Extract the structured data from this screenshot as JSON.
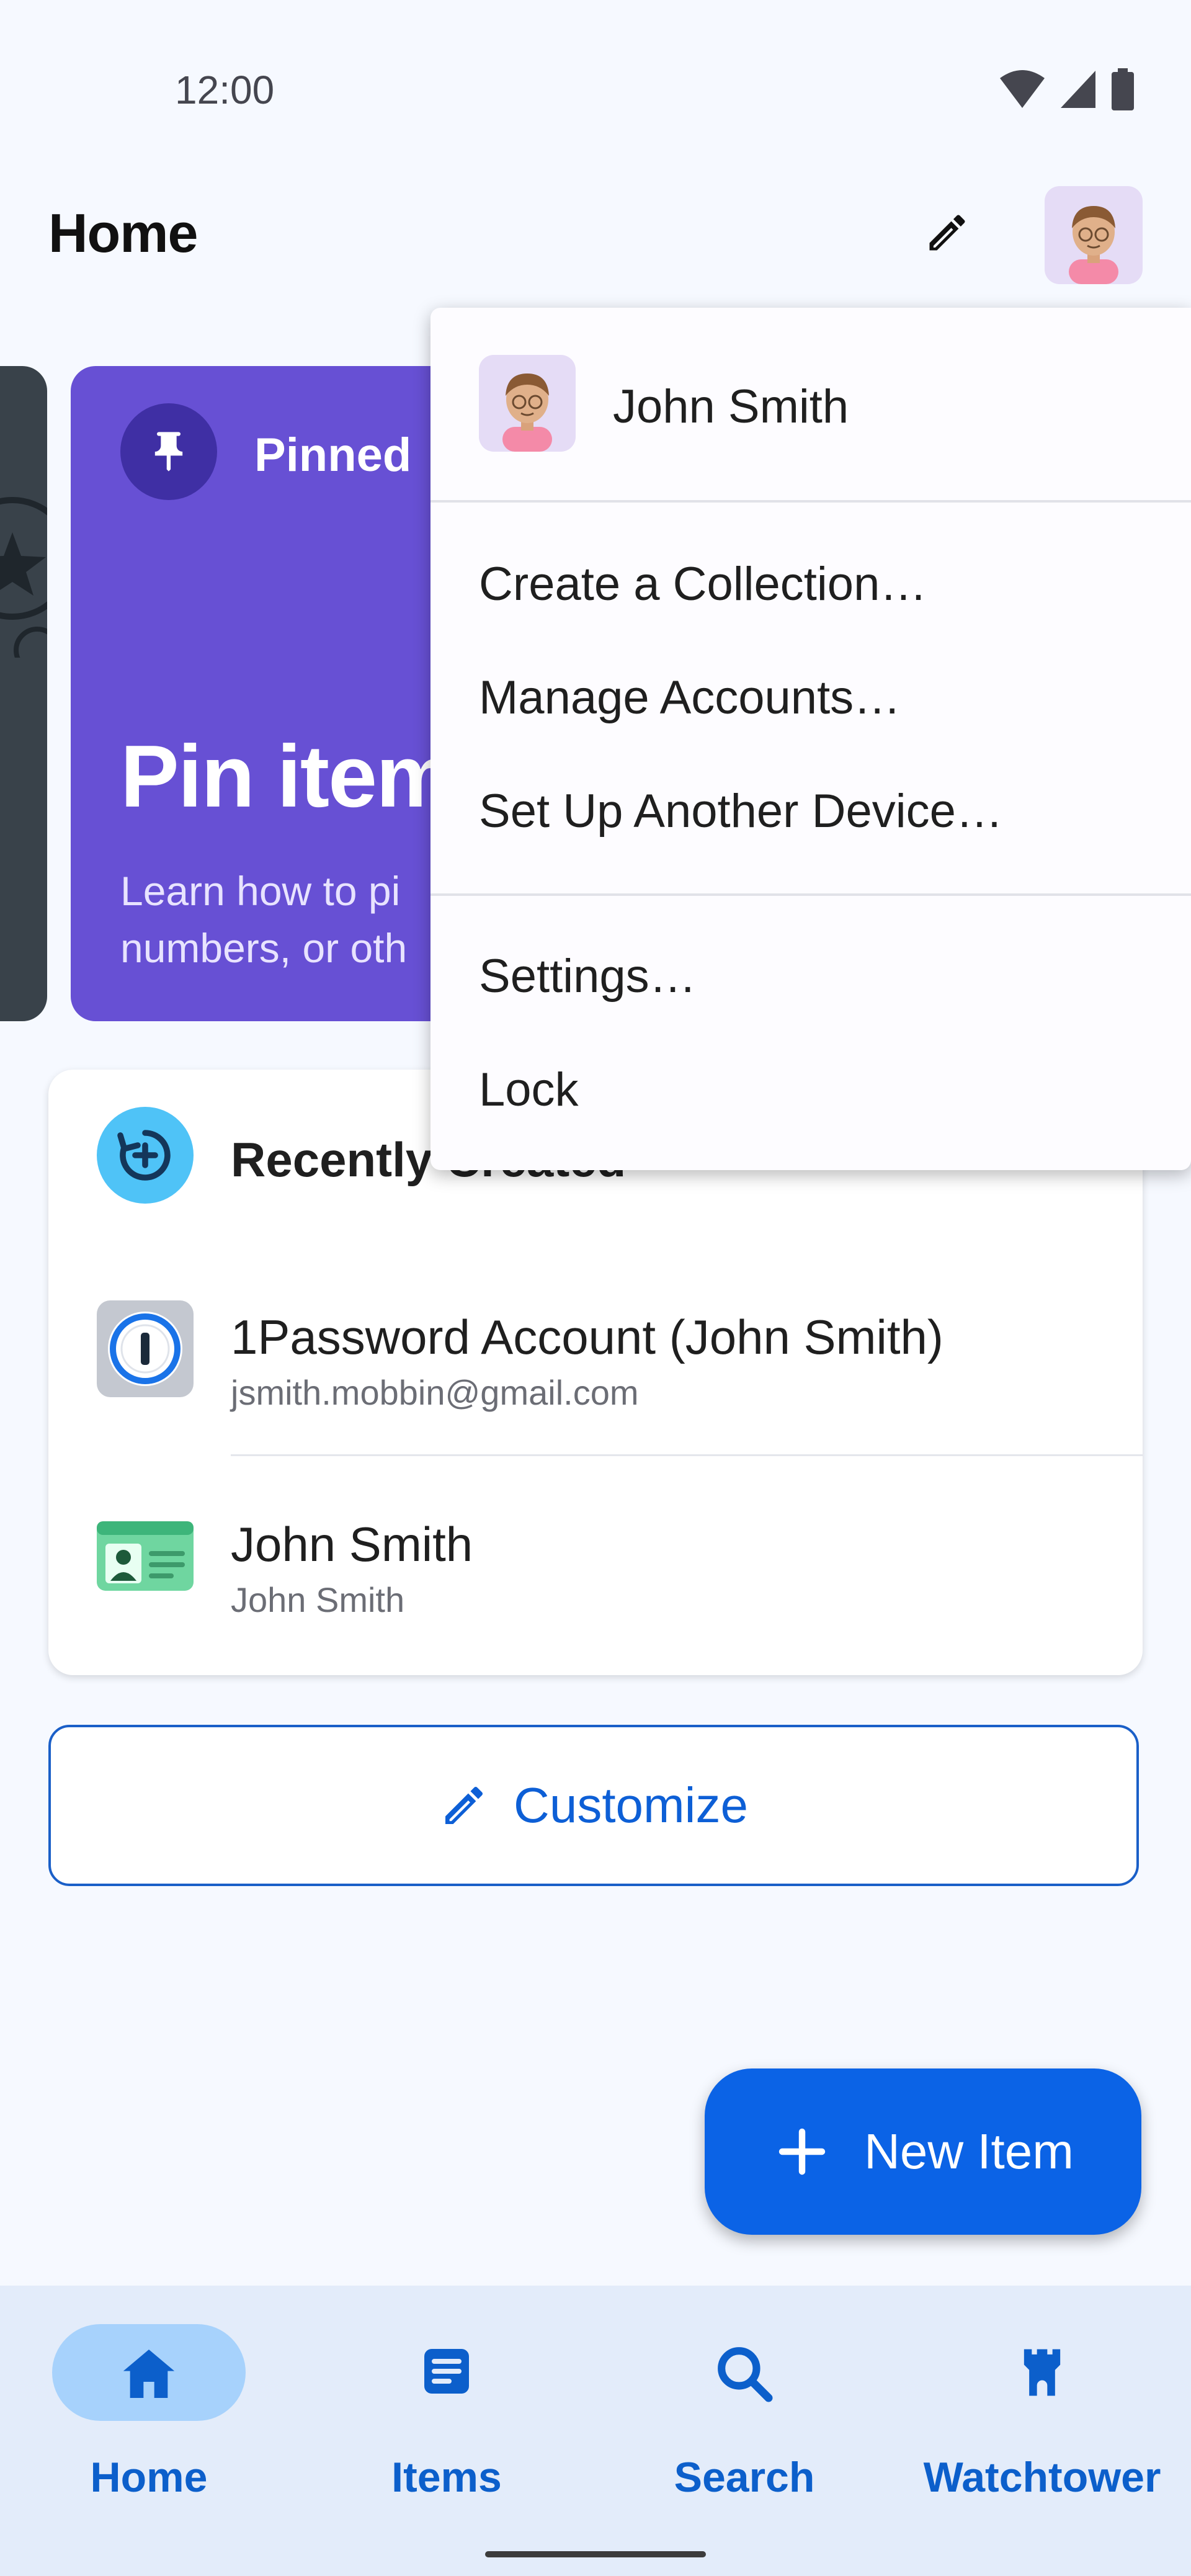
{
  "status_bar": {
    "time": "12:00"
  },
  "app_bar": {
    "title": "Home"
  },
  "carousel": {
    "pinned": {
      "label": "Pinned",
      "title": "Pin item",
      "description_line1": "Learn how to pi",
      "description_line2": "numbers, or oth"
    }
  },
  "recent": {
    "title": "Recently Created",
    "items": [
      {
        "title": "1Password Account (John Smith)",
        "subtitle": "jsmith.mobbin@gmail.com",
        "icon": "1password-icon"
      },
      {
        "title": "John Smith",
        "subtitle": "John Smith",
        "icon": "identity-card-icon"
      }
    ]
  },
  "customize": {
    "label": "Customize"
  },
  "fab": {
    "label": "New Item"
  },
  "bottom_nav": {
    "items": [
      {
        "label": "Home",
        "icon": "home-icon",
        "active": true
      },
      {
        "label": "Items",
        "icon": "list-icon",
        "active": false
      },
      {
        "label": "Search",
        "icon": "search-icon",
        "active": false
      },
      {
        "label": "Watchtower",
        "icon": "watchtower-icon",
        "active": false
      }
    ]
  },
  "account_menu": {
    "user_name": "John Smith",
    "items": [
      "Create a Collection…",
      "Manage Accounts…",
      "Set Up Another Device…",
      "Settings…",
      "Lock"
    ]
  },
  "colors": {
    "accent": "#0b63e6",
    "pinned_card": "#6750d4",
    "nav_background": "#e3ecfa",
    "nav_active_pill": "#a7d2fc"
  }
}
